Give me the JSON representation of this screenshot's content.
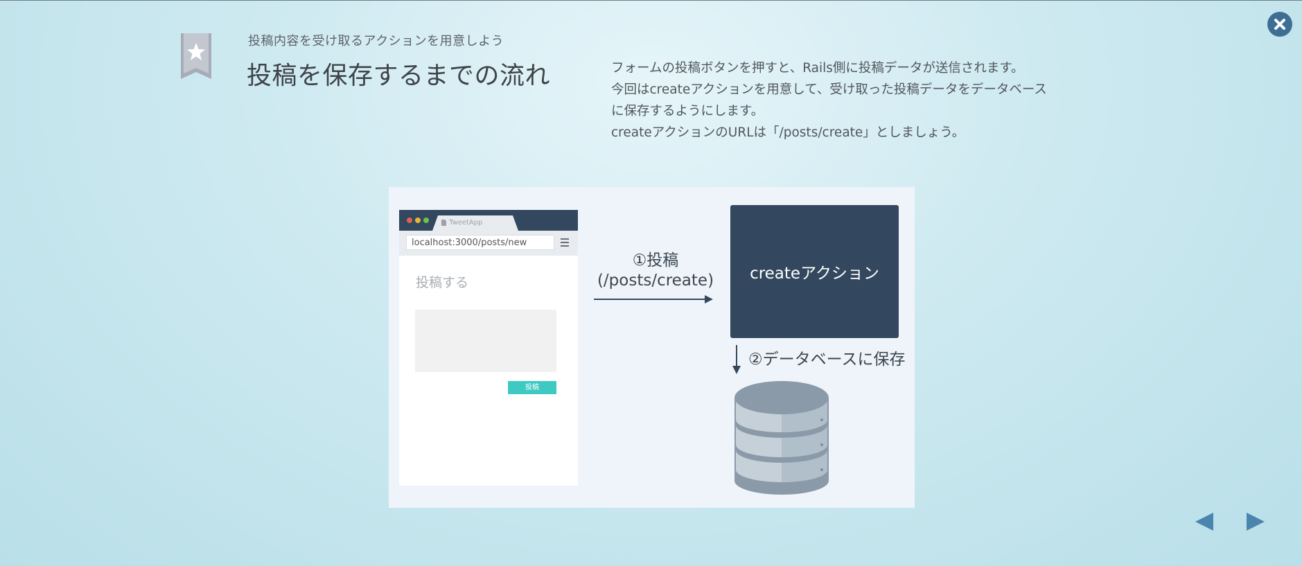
{
  "header": {
    "subtitle": "投稿内容を受け取るアクションを用意しよう",
    "title": "投稿を保存するまでの流れ"
  },
  "description": {
    "lines": [
      "フォームの投稿ボタンを押すと、Rails側に投稿データが送信されます。",
      "今回はcreateアクションを用意して、受け取った投稿データをデータベース",
      "に保存するようにします。",
      "createアクションのURLは「/posts/create」としましょう。"
    ]
  },
  "diagram": {
    "browser": {
      "tab_title": "TweetApp",
      "url": "localhost:3000/posts/new",
      "form_heading": "投稿する",
      "submit_label": "投稿"
    },
    "step1": {
      "line1": "①投稿",
      "line2": "(/posts/create)"
    },
    "action_label": "createアクション",
    "step2": "②データベースに保存"
  },
  "icons": {
    "close": "close-icon",
    "bookmark": "star-bookmark-icon",
    "prev": "triangle-left-icon",
    "next": "triangle-right-icon",
    "database": "database-icon"
  },
  "colors": {
    "accent_dark": "#33485e",
    "close_button": "#3d6f95",
    "post_button": "#3ec9c3",
    "nav_arrows": "#4a85b0"
  }
}
